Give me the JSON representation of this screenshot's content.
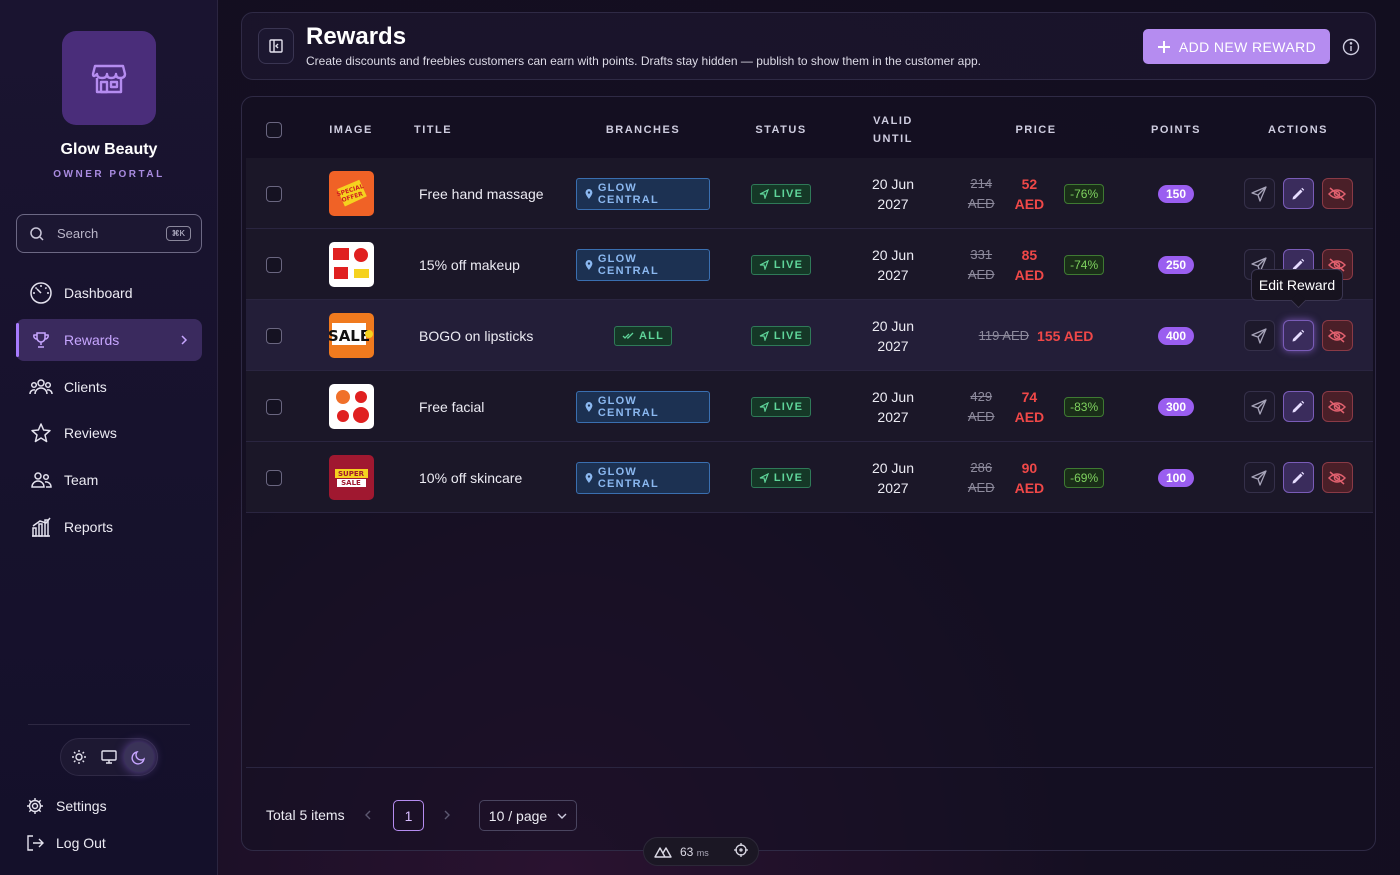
{
  "brand": {
    "name": "Glow Beauty",
    "subtitle": "OWNER PORTAL"
  },
  "search": {
    "label": "Search",
    "shortcut": "⌘K"
  },
  "nav": [
    {
      "label": "Dashboard",
      "icon": "gauge-icon"
    },
    {
      "label": "Rewards",
      "icon": "trophy-icon",
      "active": true
    },
    {
      "label": "Clients",
      "icon": "users-icon"
    },
    {
      "label": "Reviews",
      "icon": "star-icon"
    },
    {
      "label": "Team",
      "icon": "team-icon"
    },
    {
      "label": "Reports",
      "icon": "chart-icon"
    }
  ],
  "theme": {
    "options": [
      "light",
      "system",
      "dark"
    ],
    "selected": "dark"
  },
  "bottom": {
    "settings": "Settings",
    "logout": "Log Out"
  },
  "header": {
    "title": "Rewards",
    "description": "Create discounts and freebies customers can earn with points. Drafts stay hidden — publish to show them in the customer app.",
    "add_button": "ADD NEW REWARD"
  },
  "table": {
    "columns": {
      "image": "IMAGE",
      "title": "TITLE",
      "branches": "BRANCHES",
      "status": "STATUS",
      "valid_line1": "VALID",
      "valid_line2": "UNTIL",
      "price": "PRICE",
      "points": "POINTS",
      "actions": "ACTIONS"
    },
    "rows": [
      {
        "title": "Free hand massage",
        "branch": "GLOW CENTRAL",
        "status": "LIVE",
        "valid_line1": "20 Jun",
        "valid_line2": "2027",
        "old_price_num": "214",
        "old_price_cur": "AED",
        "new_price_num": "52",
        "new_price_cur": "AED",
        "discount": "-76%",
        "points": "150"
      },
      {
        "title": "15% off makeup",
        "branch": "GLOW CENTRAL",
        "status": "LIVE",
        "valid_line1": "20 Jun",
        "valid_line2": "2027",
        "old_price_num": "331",
        "old_price_cur": "AED",
        "new_price_num": "85",
        "new_price_cur": "AED",
        "discount": "-74%",
        "points": "250"
      },
      {
        "title": "BOGO on lipsticks",
        "branch": "ALL",
        "status": "LIVE",
        "valid_line1": "20 Jun",
        "valid_line2": "2027",
        "old_price": "119 AED",
        "new_price": "155 AED",
        "points": "400"
      },
      {
        "title": "Free facial",
        "branch": "GLOW CENTRAL",
        "status": "LIVE",
        "valid_line1": "20 Jun",
        "valid_line2": "2027",
        "old_price_num": "429",
        "old_price_cur": "AED",
        "new_price_num": "74",
        "new_price_cur": "AED",
        "discount": "-83%",
        "points": "300"
      },
      {
        "title": "10% off skincare",
        "branch": "GLOW CENTRAL",
        "status": "LIVE",
        "valid_line1": "20 Jun",
        "valid_line2": "2027",
        "old_price_num": "286",
        "old_price_cur": "AED",
        "new_price_num": "90",
        "new_price_cur": "AED",
        "discount": "-69%",
        "points": "100"
      }
    ],
    "thumb_texts": {
      "special": "SPECIAL OFFER",
      "sale": "SALE",
      "super": "SUPER SALE"
    }
  },
  "tooltip": "Edit Reward",
  "pagination": {
    "total": "Total 5 items",
    "current_page": "1",
    "page_size": "10 / page"
  },
  "devbar": {
    "time_value": "63",
    "time_unit": "ms"
  },
  "colors": {
    "accent": "#b58cf0",
    "price_red": "#f04848",
    "live_green": "#5fd59a",
    "branch_blue": "#8bb8f0"
  }
}
